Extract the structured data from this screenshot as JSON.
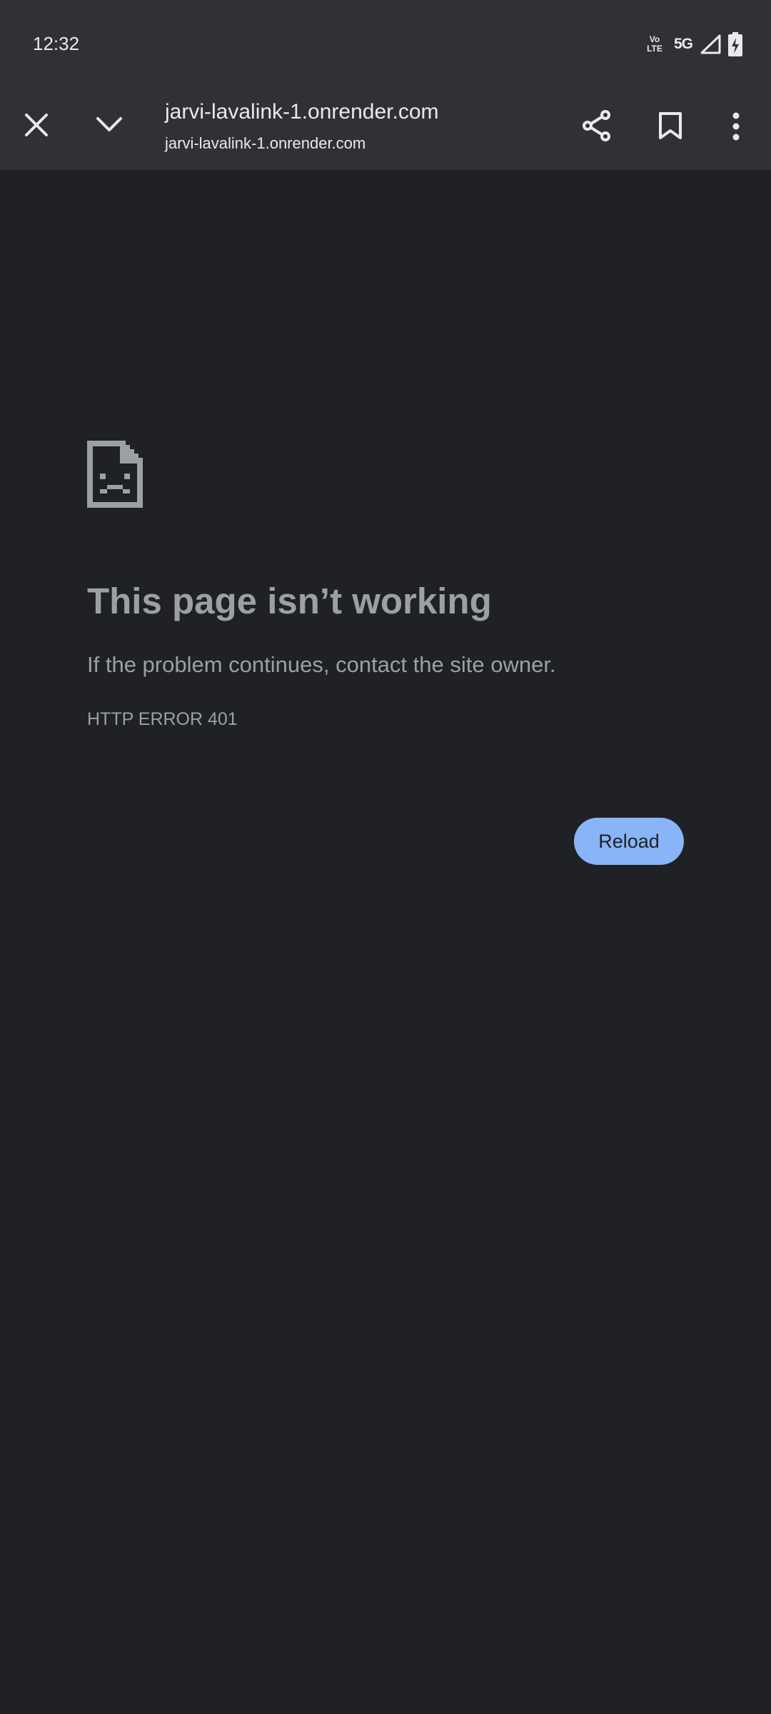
{
  "status_bar": {
    "time": "12:32",
    "volte_line1": "Vo",
    "volte_line2": "LTE",
    "network": "5G"
  },
  "toolbar": {
    "title": "jarvi-lavalink-1.onrender.com",
    "url": "jarvi-lavalink-1.onrender.com",
    "icons": [
      "close-icon",
      "chevron-down-icon",
      "share-icon",
      "bookmark-icon",
      "more-vert-icon"
    ]
  },
  "error_page": {
    "icon": "sad-page-icon",
    "title": "This page isn’t working",
    "description": "If the problem continues, contact the site owner.",
    "error_code": "HTTP ERROR 401",
    "reload_label": "Reload"
  },
  "colors": {
    "page_background": "#202124",
    "toolbar_background": "#303134",
    "error_text": "#9aa0a6",
    "reload_button": "#8ab4f8"
  }
}
